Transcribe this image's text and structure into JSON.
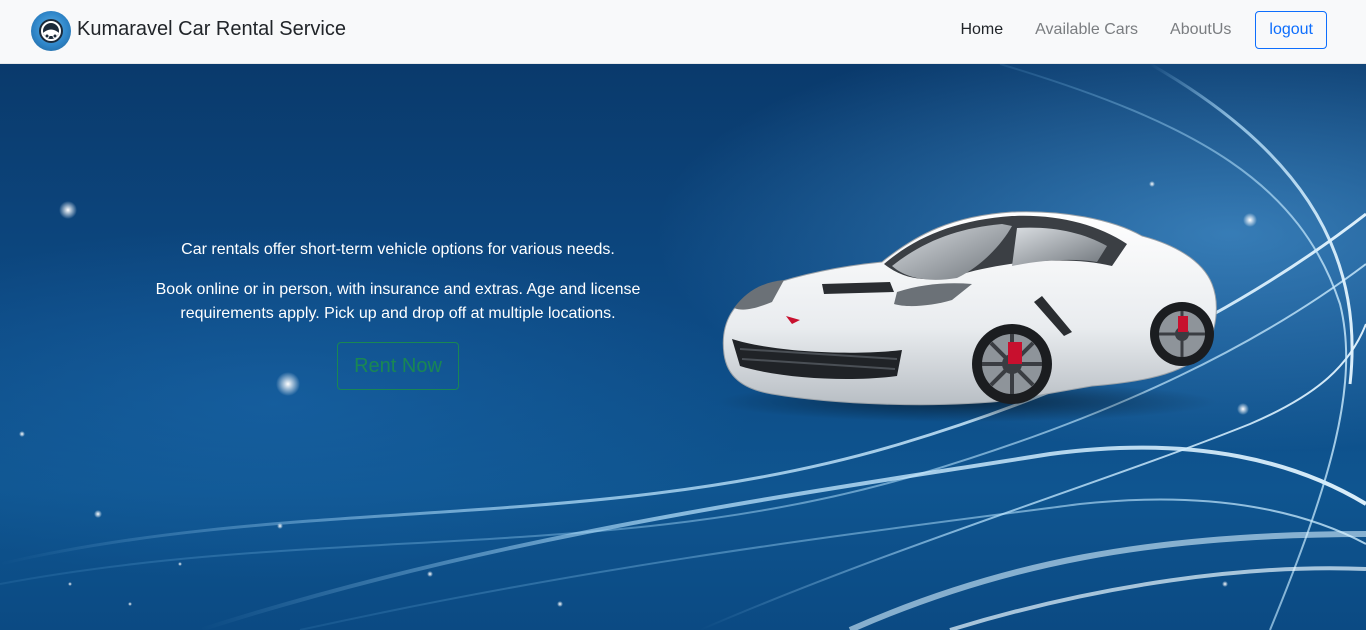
{
  "navbar": {
    "brand_name": "Kumaravel Car Rental Service",
    "logo_icon": "car-steering-logo-icon",
    "links": [
      {
        "label": "Home",
        "active": true
      },
      {
        "label": "Available Cars",
        "active": false
      },
      {
        "label": "AboutUs",
        "active": false
      }
    ],
    "logout_label": "logout"
  },
  "hero": {
    "paragraph_1": "Car rentals offer short-term vehicle options for various needs.",
    "paragraph_2": "Book online or in person, with insurance and extras. Age and license requirements apply. Pick up and drop off at multiple locations.",
    "cta_label": "Rent Now",
    "image": "white-sports-car-image"
  },
  "colors": {
    "primary": "#0d6efd",
    "success": "#198754",
    "navbar_bg": "#f8f9fa",
    "hero_bg": "#0d4a84"
  }
}
